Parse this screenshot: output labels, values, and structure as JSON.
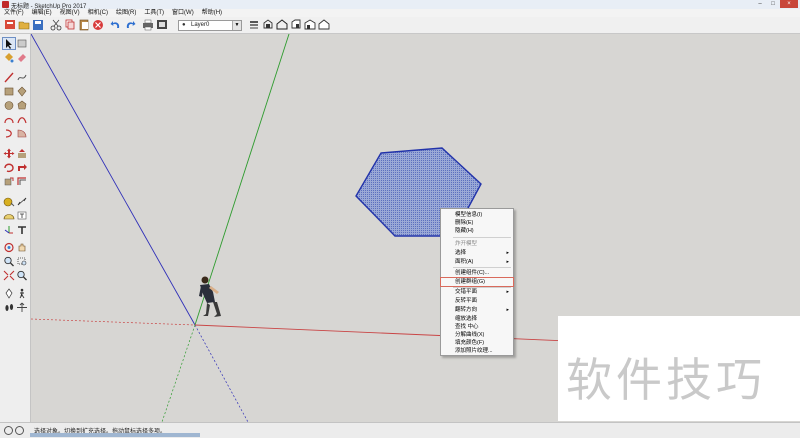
{
  "window": {
    "title": "无标题 - SketchUp Pro 2017"
  },
  "window_controls": {
    "minimize": "–",
    "maximize": "□",
    "close": "×"
  },
  "menu": {
    "items": [
      "文件(F)",
      "编辑(E)",
      "视图(V)",
      "相机(C)",
      "绘图(R)",
      "工具(T)",
      "窗口(W)",
      "帮助(H)"
    ]
  },
  "toolbar": {
    "layer_value": "Layer0",
    "layer_current_marker": "●"
  },
  "context_menu": {
    "items": [
      {
        "label": "模型信息(I)",
        "disabled": false,
        "submenu": false
      },
      {
        "label": "删除(E)",
        "disabled": false,
        "submenu": false
      },
      {
        "label": "隐藏(H)",
        "disabled": false,
        "submenu": false
      },
      {
        "label": "炸开模型",
        "disabled": true,
        "submenu": false
      },
      {
        "label": "选择",
        "disabled": false,
        "submenu": true
      },
      {
        "label": "面积(A)",
        "disabled": false,
        "submenu": true
      },
      {
        "label": "创建组件(C)...",
        "disabled": false,
        "submenu": false
      },
      {
        "label": "创建群组(G)",
        "disabled": false,
        "submenu": false,
        "highlighted": true
      },
      {
        "label": "交错平面",
        "disabled": false,
        "submenu": true
      },
      {
        "label": "反转平面",
        "disabled": false,
        "submenu": false
      },
      {
        "label": "翻转方向",
        "disabled": false,
        "submenu": true
      },
      {
        "label": "缩放选择",
        "disabled": false,
        "submenu": false
      },
      {
        "label": "查找 中心",
        "disabled": false,
        "submenu": false
      },
      {
        "label": "分解曲线(X)",
        "disabled": false,
        "submenu": false
      },
      {
        "label": "填充颜色(F)",
        "disabled": false,
        "submenu": false
      },
      {
        "label": "添加照片纹理...",
        "disabled": false,
        "submenu": false
      }
    ],
    "submenu_marker": "▸"
  },
  "statusbar": {
    "text": "选择对象。切换到扩充选择。拖动鼠标选择多项。"
  },
  "watermark": {
    "text": "软件技巧"
  },
  "colors": {
    "viewport": "#d7d6d3",
    "face_fill": "#8d9fcf",
    "face_edge": "#2233aa",
    "axis_red": "#c94545",
    "axis_green": "#2f9c2f",
    "axis_blue": "#3030b8"
  }
}
